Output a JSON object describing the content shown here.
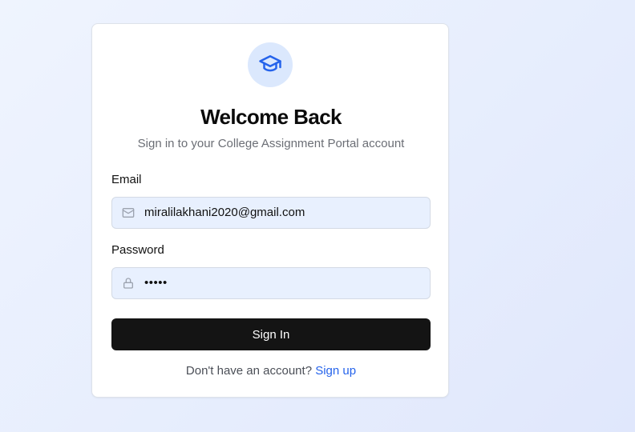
{
  "header": {
    "icon": "graduation-cap-icon",
    "title": "Welcome Back",
    "subtitle": "Sign in to your College Assignment Portal account"
  },
  "form": {
    "email": {
      "label": "Email",
      "value": "miralilakhani2020@gmail.com",
      "icon": "mail-icon"
    },
    "password": {
      "label": "Password",
      "masked_value": "•••••",
      "icon": "lock-icon"
    },
    "submit_label": "Sign In"
  },
  "footer": {
    "prompt": "Don't have an account?",
    "link_label": "Sign up"
  },
  "colors": {
    "accent": "#2563eb",
    "button_bg": "#141414",
    "input_bg": "#e8f0fe",
    "icon_circle_bg": "#dbe8fd"
  }
}
